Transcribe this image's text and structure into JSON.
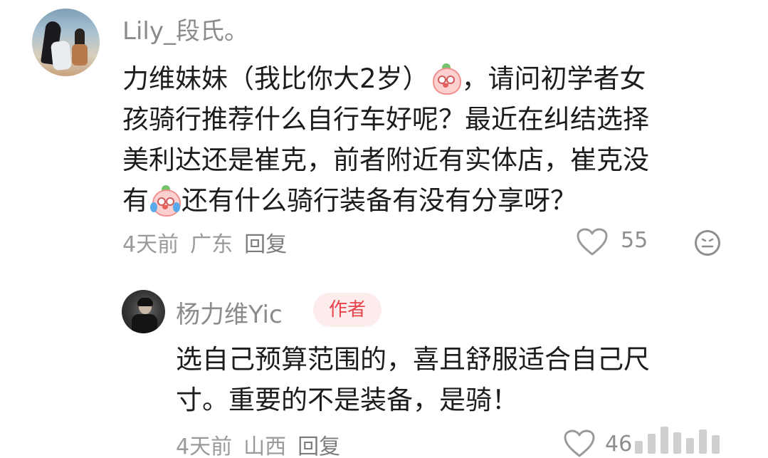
{
  "main_comment": {
    "username": "Lily_段氏。",
    "text_line1_a": "力维妹妹（我比你大2岁）",
    "text_line1_b": "，请问初学者女",
    "text_line2": "孩骑行推荐什么自行车好呢？最近在纠结选择",
    "text_line3": "美利达还是崔克，前者附近有实体店，崔克没",
    "text_line4_a": "有",
    "text_line4_b": "还有什么骑行装备有没有分享呀？",
    "time": "4天前",
    "location": "广东",
    "reply_label": "回复",
    "like_count": "55",
    "emoji_1": "shy-peach-emoji",
    "emoji_2": "crying-peach-emoji"
  },
  "reply_comment": {
    "username": "杨力维Yic",
    "badge": "作者",
    "text_line1": "选自己预算范围的，喜且舒服适合自己尺",
    "text_line2": "寸。重要的不是装备，是骑！",
    "time": "4天前",
    "location": "山西",
    "reply_label": "回复",
    "like_count_partial": "46"
  },
  "colors": {
    "badge_bg": "#fdecec",
    "badge_text": "#e8424a",
    "meta_text": "#9a9a9a",
    "body_text": "#1c1c1c"
  }
}
